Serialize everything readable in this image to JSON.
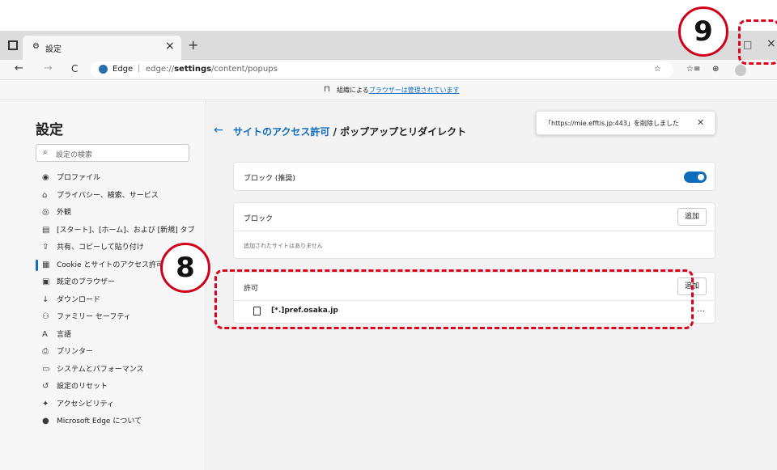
{
  "window": {
    "tab_title": "設定",
    "tab_close": "×",
    "new_tab": "+",
    "minimize": "□",
    "close": "×"
  },
  "toolbar": {
    "back": "←",
    "forward": "→",
    "refresh": "C",
    "site_name": "Edge",
    "url_prefix": "edge://",
    "url_bold": "settings",
    "url_suffix": "/content/popups",
    "ext_icons": [
      "☆",
      "☆≡",
      "⊕"
    ]
  },
  "managed_bar": {
    "prefix": "組織による",
    "link": "ブラウザーは管理されています"
  },
  "sidebar": {
    "title": "設定",
    "search_placeholder": "設定の検索",
    "items": [
      {
        "icon": "profile-icon",
        "glyph": "◉",
        "label": "プロファイル"
      },
      {
        "icon": "lock-icon",
        "glyph": "⌂",
        "label": "プライバシー、検索、サービス"
      },
      {
        "icon": "appearance-icon",
        "glyph": "◎",
        "label": "外観"
      },
      {
        "icon": "new-tab-icon",
        "glyph": "▤",
        "label": "[スタート]、[ホーム]、および [新規] タブ"
      },
      {
        "icon": "share-icon",
        "glyph": "⇪",
        "label": "共有、コピーして貼り付け"
      },
      {
        "icon": "cookie-icon",
        "glyph": "▦",
        "label": "Cookie とサイトのアクセス許可"
      },
      {
        "icon": "default-browser-icon",
        "glyph": "▣",
        "label": "既定のブラウザー"
      },
      {
        "icon": "download-icon",
        "glyph": "↓",
        "label": "ダウンロード"
      },
      {
        "icon": "family-icon",
        "glyph": "⚇",
        "label": "ファミリー セーフティ"
      },
      {
        "icon": "language-icon",
        "glyph": "A",
        "label": "言語"
      },
      {
        "icon": "printer-icon",
        "glyph": "⎙",
        "label": "プリンター"
      },
      {
        "icon": "system-icon",
        "glyph": "▭",
        "label": "システムとパフォーマンス"
      },
      {
        "icon": "reset-icon",
        "glyph": "↺",
        "label": "設定のリセット"
      },
      {
        "icon": "accessibility-icon",
        "glyph": "✦",
        "label": "アクセシビリティ"
      },
      {
        "icon": "edge-icon",
        "glyph": "●",
        "label": "Microsoft Edge について"
      }
    ]
  },
  "main": {
    "back_arrow": "←",
    "breadcrumb_link": "サイトのアクセス許可",
    "breadcrumb_sep": " / ",
    "page_title": "ポップアップとリダイレクト",
    "toast": "「https://mie.efftis.jp:443」を削除しました",
    "toast_close": "✕",
    "block_recommended": "ブロック (推奨)",
    "toggle_on": true,
    "block_title": "ブロック",
    "block_add": "追加",
    "block_empty": "追加されたサイトはありません",
    "allow_title": "許可",
    "allow_add": "追加",
    "allow_sites": [
      "[*.]pref.osaka.jp"
    ],
    "more": "…"
  },
  "annotations": {
    "step8": "8",
    "step9": "9",
    "color": "#e0001b"
  }
}
